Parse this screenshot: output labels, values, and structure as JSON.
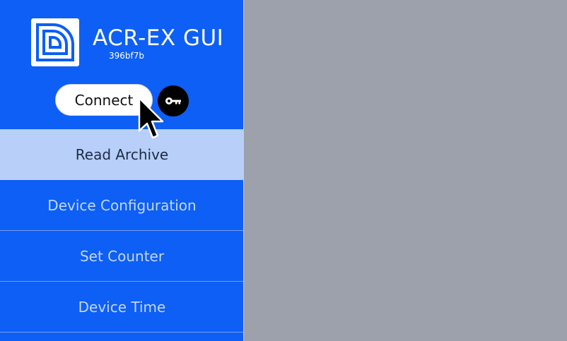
{
  "app": {
    "title": "ACR-EX GUI",
    "version": "396bf7b"
  },
  "header": {
    "connect_label": "Connect",
    "key_icon": "key-icon"
  },
  "nav": {
    "items": [
      {
        "label": "Read Archive",
        "active": true
      },
      {
        "label": "Device Configuration",
        "active": false
      },
      {
        "label": "Set Counter",
        "active": false
      },
      {
        "label": "Device Time",
        "active": false
      }
    ]
  },
  "colors": {
    "sidebar": "#0d5ff5",
    "active_item": "#b7cff9",
    "main_background": "#9ca1ab"
  }
}
